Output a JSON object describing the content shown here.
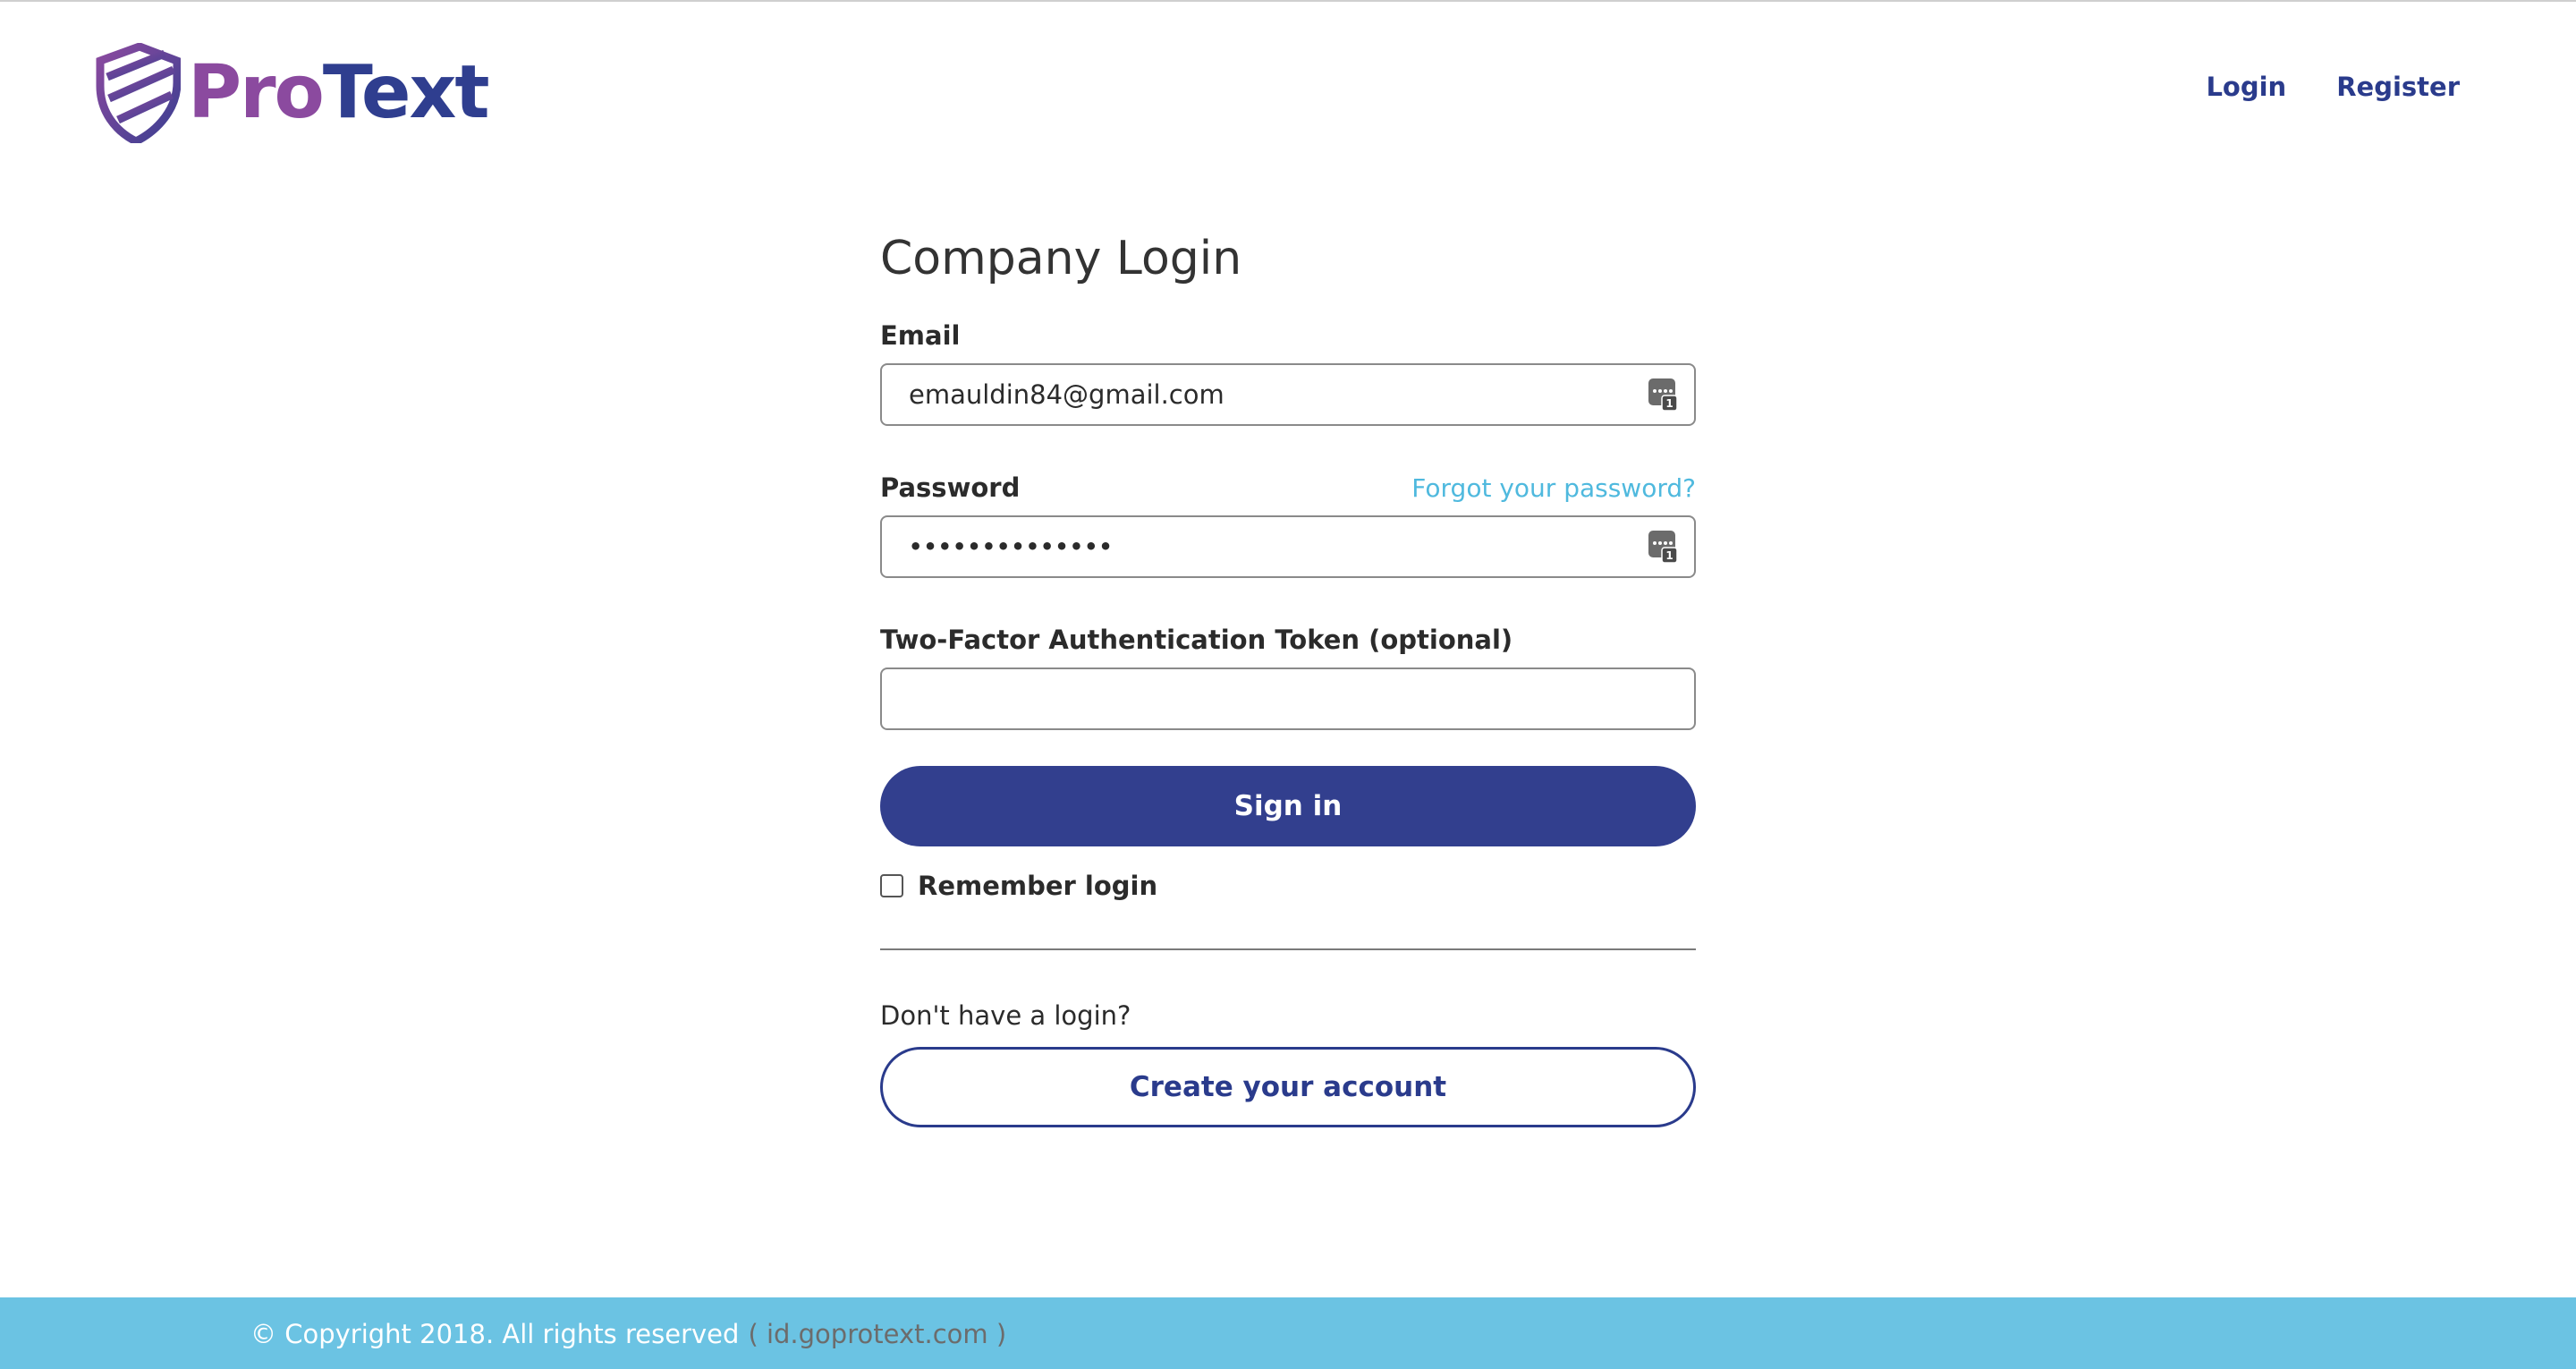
{
  "header": {
    "logo_part1": "Pro",
    "logo_part2": "Text",
    "nav": {
      "login": "Login",
      "register": "Register"
    }
  },
  "form": {
    "title": "Company Login",
    "email_label": "Email",
    "email_value": "emauldin84@gmail.com",
    "password_label": "Password",
    "forgot_link": "Forgot your password?",
    "password_value": "••••••••••••••",
    "token_label": "Two-Factor Authentication Token (optional)",
    "token_value": "",
    "signin_label": "Sign in",
    "remember_label": "Remember login",
    "remember_checked": false,
    "no_login_text": "Don't have a login?",
    "create_label": "Create your account"
  },
  "footer": {
    "copyright": "© Copyright 2018. All rights reserved",
    "domain_link": "( id.goprotext.com )"
  },
  "colors": {
    "brand_purple": "#8b4a9f",
    "brand_navy": "#323f8e",
    "link_cyan": "#4fb9de",
    "footer_bg": "#6bc3e3"
  },
  "icons": [
    "protext-shield-logo-icon",
    "password-manager-icon"
  ]
}
